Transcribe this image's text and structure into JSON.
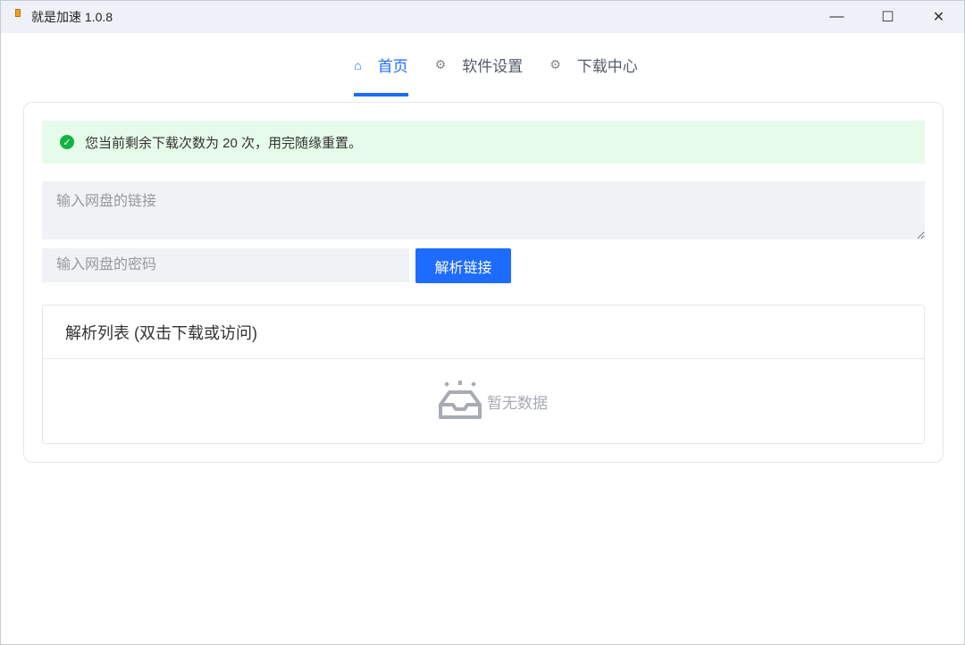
{
  "window": {
    "title": "就是加速  1.0.8",
    "minimize": "—",
    "maximize": "☐",
    "close": "✕"
  },
  "tabs": [
    {
      "label": "首页",
      "icon": "home-icon"
    },
    {
      "label": "软件设置",
      "icon": "gear-icon"
    },
    {
      "label": "下载中心",
      "icon": "gear-icon"
    }
  ],
  "alert": {
    "text": "您当前剩余下载次数为 20 次，用完随缘重置。"
  },
  "form": {
    "link_placeholder": "输入网盘的链接",
    "password_placeholder": "输入网盘的密码",
    "parse_label": "解析链接"
  },
  "list": {
    "title": "解析列表 (双击下载或访问)",
    "empty": "暂无数据"
  }
}
